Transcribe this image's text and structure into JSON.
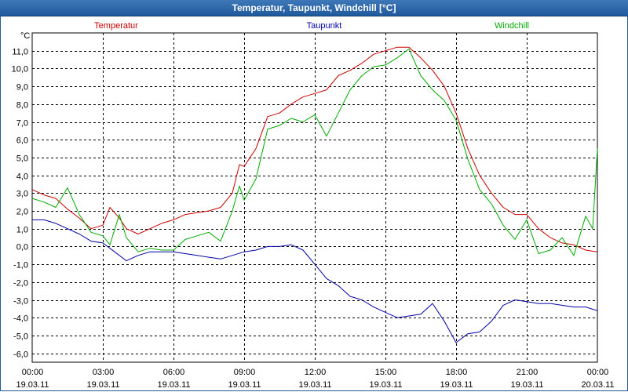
{
  "window": {
    "title": "Temperatur, Taupunkt, Windchill [°C]"
  },
  "chart_data": {
    "type": "line",
    "ylabel": "°C",
    "ylim": [
      -6.5,
      12.0
    ],
    "y_ticks": [
      "11,0",
      "10,0",
      "9,0",
      "8,0",
      "7,0",
      "6,0",
      "5,0",
      "4,0",
      "3,0",
      "2,0",
      "1,0",
      "0,0",
      "-1,0",
      "-2,0",
      "-3,0",
      "-4,0",
      "-5,0",
      "-6,0"
    ],
    "y_tick_values": [
      11,
      10,
      9,
      8,
      7,
      6,
      5,
      4,
      3,
      2,
      1,
      0,
      -1,
      -2,
      -3,
      -4,
      -5,
      -6
    ],
    "x_range_hours": [
      0,
      24
    ],
    "x_ticks": [
      {
        "hours": 0,
        "time": "00:00",
        "date": "19.03.11"
      },
      {
        "hours": 3,
        "time": "03:00",
        "date": "19.03.11"
      },
      {
        "hours": 6,
        "time": "06:00",
        "date": "19.03.11"
      },
      {
        "hours": 9,
        "time": "09:00",
        "date": "19.03.11"
      },
      {
        "hours": 12,
        "time": "12:00",
        "date": "19.03.11"
      },
      {
        "hours": 15,
        "time": "15:00",
        "date": "19.03.11"
      },
      {
        "hours": 18,
        "time": "18:00",
        "date": "19.03.11"
      },
      {
        "hours": 21,
        "time": "21:00",
        "date": "19.03.11"
      },
      {
        "hours": 24,
        "time": "00:00",
        "date": "20.03.11"
      }
    ],
    "grid": true,
    "legend": "top",
    "series": [
      {
        "name": "Temperatur",
        "color": "#cc0000",
        "points": [
          [
            0,
            3.2
          ],
          [
            0.5,
            2.9
          ],
          [
            1,
            2.7
          ],
          [
            1.5,
            2.1
          ],
          [
            2,
            1.6
          ],
          [
            2.5,
            1.0
          ],
          [
            3,
            1.2
          ],
          [
            3.3,
            2.2
          ],
          [
            3.7,
            1.6
          ],
          [
            4,
            1.0
          ],
          [
            4.5,
            0.7
          ],
          [
            5,
            1.0
          ],
          [
            5.5,
            1.3
          ],
          [
            6,
            1.5
          ],
          [
            6.5,
            1.8
          ],
          [
            7,
            1.9
          ],
          [
            7.5,
            2.0
          ],
          [
            8,
            2.2
          ],
          [
            8.5,
            3.0
          ],
          [
            8.8,
            4.6
          ],
          [
            9,
            4.5
          ],
          [
            9.5,
            5.5
          ],
          [
            10,
            7.3
          ],
          [
            10.5,
            7.5
          ],
          [
            11,
            8.0
          ],
          [
            11.5,
            8.4
          ],
          [
            12,
            8.6
          ],
          [
            12.5,
            8.8
          ],
          [
            13,
            9.6
          ],
          [
            13.5,
            9.9
          ],
          [
            14,
            10.3
          ],
          [
            14.5,
            10.8
          ],
          [
            15,
            11.0
          ],
          [
            15.5,
            11.2
          ],
          [
            16,
            11.2
          ],
          [
            16.5,
            10.6
          ],
          [
            17,
            9.9
          ],
          [
            17.5,
            9.0
          ],
          [
            18,
            7.5
          ],
          [
            18.5,
            5.5
          ],
          [
            19,
            4.0
          ],
          [
            19.5,
            3.0
          ],
          [
            20,
            2.2
          ],
          [
            20.5,
            1.8
          ],
          [
            21,
            1.8
          ],
          [
            21.5,
            1.0
          ],
          [
            22,
            0.5
          ],
          [
            22.5,
            0.2
          ],
          [
            23,
            0.1
          ],
          [
            23.5,
            -0.2
          ],
          [
            24,
            -0.3
          ]
        ]
      },
      {
        "name": "Taupunkt",
        "color": "#0000aa",
        "points": [
          [
            0,
            1.5
          ],
          [
            0.5,
            1.5
          ],
          [
            1,
            1.3
          ],
          [
            1.5,
            1.0
          ],
          [
            2,
            0.7
          ],
          [
            2.5,
            0.3
          ],
          [
            3,
            0.2
          ],
          [
            3.5,
            -0.3
          ],
          [
            4,
            -0.8
          ],
          [
            4.5,
            -0.5
          ],
          [
            5,
            -0.3
          ],
          [
            5.5,
            -0.3
          ],
          [
            6,
            -0.3
          ],
          [
            6.5,
            -0.4
          ],
          [
            7,
            -0.5
          ],
          [
            7.5,
            -0.6
          ],
          [
            8,
            -0.7
          ],
          [
            8.5,
            -0.5
          ],
          [
            9,
            -0.3
          ],
          [
            9.5,
            -0.2
          ],
          [
            10,
            0.0
          ],
          [
            10.5,
            0.0
          ],
          [
            11,
            0.1
          ],
          [
            11.5,
            -0.2
          ],
          [
            12,
            -1.0
          ],
          [
            12.5,
            -1.8
          ],
          [
            13,
            -2.2
          ],
          [
            13.5,
            -2.8
          ],
          [
            14,
            -3.0
          ],
          [
            14.5,
            -3.4
          ],
          [
            15,
            -3.7
          ],
          [
            15.5,
            -4.0
          ],
          [
            16,
            -3.9
          ],
          [
            16.5,
            -3.8
          ],
          [
            17,
            -3.2
          ],
          [
            17.5,
            -4.2
          ],
          [
            18,
            -5.4
          ],
          [
            18.5,
            -4.9
          ],
          [
            19,
            -4.8
          ],
          [
            19.5,
            -4.2
          ],
          [
            20,
            -3.3
          ],
          [
            20.5,
            -3.0
          ],
          [
            21,
            -3.1
          ],
          [
            21.5,
            -3.2
          ],
          [
            22,
            -3.2
          ],
          [
            22.5,
            -3.3
          ],
          [
            23,
            -3.4
          ],
          [
            23.5,
            -3.4
          ],
          [
            24,
            -3.6
          ]
        ]
      },
      {
        "name": "Windchill",
        "color": "#00aa00",
        "points": [
          [
            0,
            2.7
          ],
          [
            0.5,
            2.5
          ],
          [
            1,
            2.2
          ],
          [
            1.5,
            3.3
          ],
          [
            2,
            1.8
          ],
          [
            2.5,
            0.8
          ],
          [
            3,
            0.6
          ],
          [
            3.3,
            0.1
          ],
          [
            3.7,
            1.8
          ],
          [
            4,
            0.5
          ],
          [
            4.5,
            -0.3
          ],
          [
            5,
            -0.1
          ],
          [
            5.5,
            -0.2
          ],
          [
            6,
            -0.2
          ],
          [
            6.5,
            0.4
          ],
          [
            7,
            0.6
          ],
          [
            7.5,
            0.8
          ],
          [
            8,
            0.3
          ],
          [
            8.5,
            2.0
          ],
          [
            8.8,
            3.4
          ],
          [
            9,
            2.6
          ],
          [
            9.5,
            3.8
          ],
          [
            10,
            6.6
          ],
          [
            10.5,
            6.8
          ],
          [
            11,
            7.2
          ],
          [
            11.5,
            7.0
          ],
          [
            12,
            7.4
          ],
          [
            12.5,
            6.2
          ],
          [
            13,
            7.5
          ],
          [
            13.5,
            8.8
          ],
          [
            14,
            9.6
          ],
          [
            14.5,
            10.1
          ],
          [
            15,
            10.2
          ],
          [
            15.5,
            10.6
          ],
          [
            16,
            11.1
          ],
          [
            16.5,
            9.6
          ],
          [
            17,
            8.8
          ],
          [
            17.5,
            8.2
          ],
          [
            18,
            7.1
          ],
          [
            18.5,
            4.9
          ],
          [
            19,
            3.2
          ],
          [
            19.5,
            2.4
          ],
          [
            20,
            1.2
          ],
          [
            20.5,
            0.4
          ],
          [
            21,
            1.5
          ],
          [
            21.5,
            -0.4
          ],
          [
            22,
            -0.2
          ],
          [
            22.5,
            0.5
          ],
          [
            23,
            -0.5
          ],
          [
            23.5,
            1.7
          ],
          [
            23.8,
            1.0
          ],
          [
            24,
            5.5
          ]
        ]
      }
    ]
  }
}
